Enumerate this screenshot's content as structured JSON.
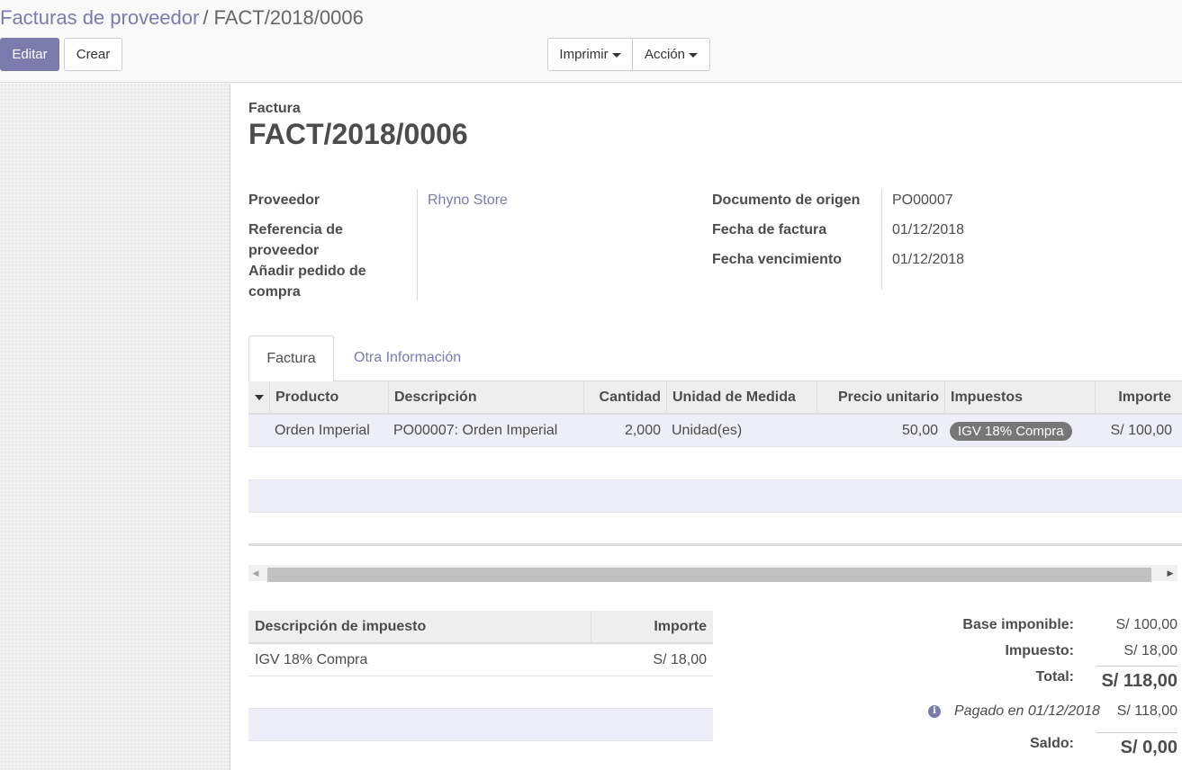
{
  "breadcrumb": {
    "parent": "Facturas de proveedor",
    "separator": "/",
    "current": "FACT/2018/0006"
  },
  "buttons": {
    "edit": "Editar",
    "create": "Crear",
    "print": "Imprimir",
    "action": "Acción"
  },
  "sheet": {
    "doc_type": "Factura",
    "title": "FACT/2018/0006",
    "left_fields": {
      "vendor_label": "Proveedor",
      "vendor_value": "Rhyno Store",
      "vendor_ref_label": "Referencia de proveedor",
      "add_po_label": "Añadir pedido de compra"
    },
    "right_fields": {
      "origin_label": "Documento de origen",
      "origin_value": "PO00007",
      "invoice_date_label": "Fecha de factura",
      "invoice_date_value": "01/12/2018",
      "due_date_label": "Fecha vencimiento",
      "due_date_value": "01/12/2018"
    }
  },
  "tabs": [
    {
      "label": "Factura",
      "active": true
    },
    {
      "label": "Otra Información",
      "active": false
    }
  ],
  "lines": {
    "columns": [
      "Producto",
      "Descripción",
      "Cantidad",
      "Unidad de Medida",
      "Precio unitario",
      "Impuestos",
      "Importe"
    ],
    "rows": [
      {
        "product": "Orden Imperial",
        "description": "PO00007: Orden Imperial",
        "quantity": "2,000",
        "uom": "Unidad(es)",
        "price": "50,00",
        "tax": "IGV 18% Compra",
        "amount": "S/ 100,00"
      }
    ]
  },
  "tax_table": {
    "columns": [
      "Descripción de impuesto",
      "Importe"
    ],
    "rows": [
      {
        "description": "IGV 18% Compra",
        "amount": "S/ 18,00"
      }
    ]
  },
  "totals": {
    "base_label": "Base imponible:",
    "base_value": "S/ 100,00",
    "tax_label": "Impuesto:",
    "tax_value": "S/ 18,00",
    "total_label": "Total:",
    "total_value": "S/ 118,00",
    "paid_text": "Pagado en 01/12/2018",
    "paid_value": "S/ 118,00",
    "balance_label": "Saldo:",
    "balance_value": "S/ 0,00"
  },
  "colors": {
    "brand": "#7c7bad",
    "badge": "#777777",
    "selected_row": "#eeeef8"
  }
}
